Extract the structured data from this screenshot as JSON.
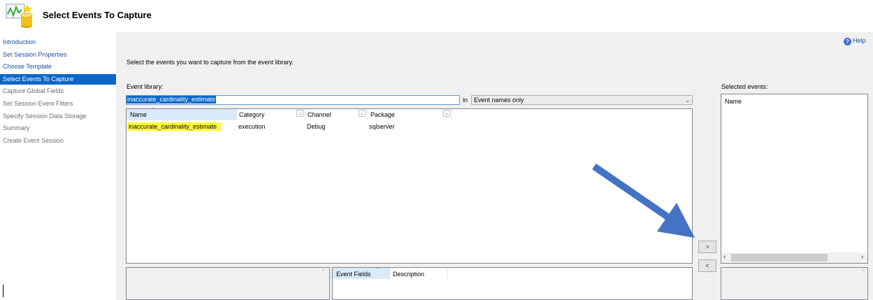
{
  "header": {
    "title": "Select Events To Capture"
  },
  "help": {
    "label": "Help"
  },
  "sidebar": {
    "items": [
      {
        "label": "Introduction",
        "state": "link"
      },
      {
        "label": "Set Session Properties",
        "state": "link"
      },
      {
        "label": "Choose Template",
        "state": "link"
      },
      {
        "label": "Select Events To Capture",
        "state": "active"
      },
      {
        "label": "Capture Global Fields",
        "state": "disabled"
      },
      {
        "label": "Set Session Event Filters",
        "state": "disabled"
      },
      {
        "label": "Specify Session Data Storage",
        "state": "disabled"
      },
      {
        "label": "Summary",
        "state": "disabled"
      },
      {
        "label": "Create Event Session",
        "state": "disabled"
      }
    ]
  },
  "main": {
    "instruction": "Select the events you want to capture from the event library.",
    "event_library_label": "Event library:",
    "search_value": "inaccurate_cardinality_estimate",
    "in_label": "in",
    "filter_value": "Event names only",
    "columns": [
      "Name",
      "Category",
      "Channel",
      "Package"
    ],
    "rows": [
      {
        "name": "inaccurate_cardinality_estimate",
        "category": "execution",
        "channel": "Debug",
        "package": "sqlserver"
      }
    ],
    "add_button": ">",
    "remove_button": "<",
    "detail_columns": [
      "Event Fields",
      "Description"
    ]
  },
  "selected": {
    "label": "Selected events:",
    "column": "Name"
  },
  "colors": {
    "active_nav": "#0a67c8",
    "link": "#1a4da6",
    "highlight": "#ffff33",
    "annotation_arrow": "#4472c4"
  }
}
